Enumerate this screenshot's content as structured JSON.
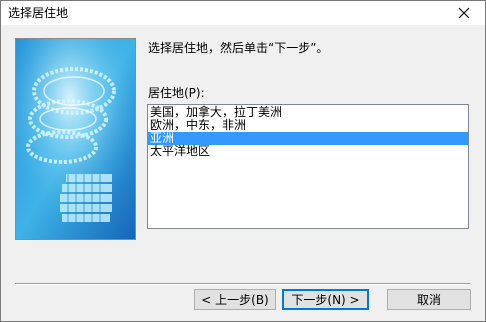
{
  "window": {
    "title": "选择居住地"
  },
  "main": {
    "prompt": "选择居住地，然后单击“下一步”。",
    "list_label": "居住地(P):",
    "regions": [
      {
        "label": "美国，加拿大，拉丁美洲",
        "selected": false
      },
      {
        "label": "欧洲，中东，非洲",
        "selected": false
      },
      {
        "label": "亚洲",
        "selected": true
      },
      {
        "label": "太平洋地区",
        "selected": false
      }
    ]
  },
  "buttons": {
    "back_label": "< 上一步(B)",
    "next_label": "下一步(N) >",
    "cancel_label": "取消"
  },
  "colors": {
    "selection": "#3399ff",
    "focus_border": "#0078d7"
  }
}
